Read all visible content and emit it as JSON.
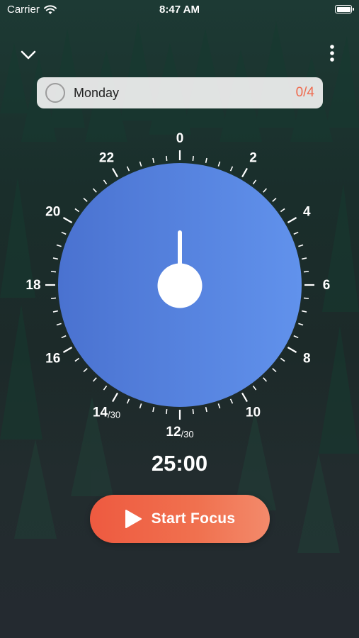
{
  "status_bar": {
    "carrier": "Carrier",
    "time": "8:47 AM"
  },
  "task": {
    "name": "Monday",
    "count": "0/4"
  },
  "dial": {
    "labels": [
      {
        "text": "0",
        "angle": 0
      },
      {
        "text": "2",
        "angle": 30
      },
      {
        "text": "4",
        "angle": 60
      },
      {
        "text": "6",
        "angle": 90
      },
      {
        "text": "8",
        "angle": 120
      },
      {
        "text": "10",
        "angle": 150
      },
      {
        "text": "12",
        "sub": "/30",
        "angle": 180
      },
      {
        "text": "14",
        "sub": "/30",
        "angle": 210
      },
      {
        "text": "16",
        "angle": 240
      },
      {
        "text": "18",
        "angle": 270
      },
      {
        "text": "20",
        "angle": 300
      },
      {
        "text": "22",
        "angle": 330
      }
    ],
    "tick_count": 60,
    "face_color_left": "#4a72d0",
    "face_color_right": "#6192ec"
  },
  "timer": {
    "display": "25:00"
  },
  "start_button": {
    "label": "Start Focus"
  },
  "icons": {
    "collapse": "chevron-down-icon",
    "more": "more-vertical-icon",
    "wifi": "wifi-icon",
    "battery": "battery-icon",
    "play": "play-icon"
  }
}
